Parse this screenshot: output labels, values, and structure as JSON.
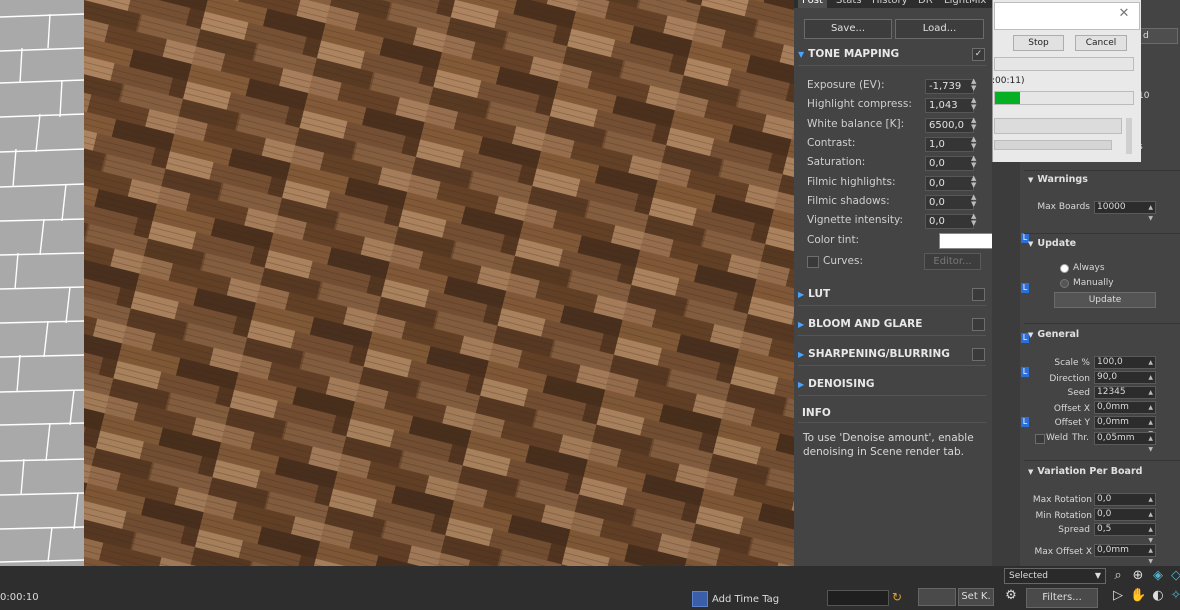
{
  "post_panel": {
    "tabs": [
      "Post",
      "Stats",
      "History",
      "DR",
      "LightMix"
    ],
    "active_tab": "Post",
    "save_label": "Save...",
    "load_label": "Load...",
    "tone_mapping": {
      "title": "TONE MAPPING",
      "enabled": true,
      "params": [
        {
          "label": "Exposure (EV):",
          "value": "-1,739"
        },
        {
          "label": "Highlight compress:",
          "value": "1,043"
        },
        {
          "label": "White balance [K]:",
          "value": "6500,0"
        },
        {
          "label": "Contrast:",
          "value": "1,0"
        },
        {
          "label": "Saturation:",
          "value": "0,0"
        },
        {
          "label": "Filmic highlights:",
          "value": "0,0"
        },
        {
          "label": "Filmic shadows:",
          "value": "0,0"
        },
        {
          "label": "Vignette intensity:",
          "value": "0,0"
        }
      ],
      "color_tint_label": "Color tint:",
      "color_tint_value": "#ffffff",
      "curves_label": "Curves:",
      "editor_label": "Editor..."
    },
    "sections": [
      "LUT",
      "BLOOM AND GLARE",
      "SHARPENING/BLURRING",
      "DENOISING"
    ],
    "info_title": "INFO",
    "info_text": "To use 'Denoise amount', enable denoising in Scene render tab."
  },
  "progress_dialog": {
    "stop_label": "Stop",
    "cancel_label": "Cancel",
    "elapsed": ":00:11)",
    "progress": 0.18,
    "bg_load_label": "d",
    "bg_ten": "10",
    "bg_s": "s"
  },
  "command_panel": {
    "warnings": {
      "title": "Warnings",
      "max_boards_label": "Max Boards",
      "max_boards_value": "10000"
    },
    "update": {
      "title": "Update",
      "always_label": "Always",
      "manually_label": "Manually",
      "update_button": "Update",
      "selected_option": "Always"
    },
    "general": {
      "title": "General",
      "scale_label": "Scale %",
      "scale_value": "100,0",
      "direction_label": "Direction",
      "direction_value": "90,0",
      "seed_label": "Seed",
      "seed_value": "12345",
      "offset_x_label": "Offset X",
      "offset_x_value": "0,0mm",
      "offset_y_label": "Offset Y",
      "offset_y_value": "0,0mm",
      "weld_label": "Weld",
      "thr_label": "Thr.",
      "thr_value": "0,05mm"
    },
    "variation": {
      "title": "Variation Per Board",
      "max_rotation_label": "Max Rotation",
      "max_rotation_value": "0,0",
      "min_rotation_label": "Min Rotation",
      "min_rotation_value": "0,0",
      "spread_label": "Spread",
      "spread_value": "0,5",
      "max_offset_x_label": "Max Offset X",
      "max_offset_x_value": "0,0mm"
    }
  },
  "bottom_bar": {
    "timecode": "0:00:10",
    "add_time_tag": "Add Time Tag",
    "set_key": "Set K.",
    "selected_dropdown": "Selected",
    "filters_label": "Filters..."
  }
}
